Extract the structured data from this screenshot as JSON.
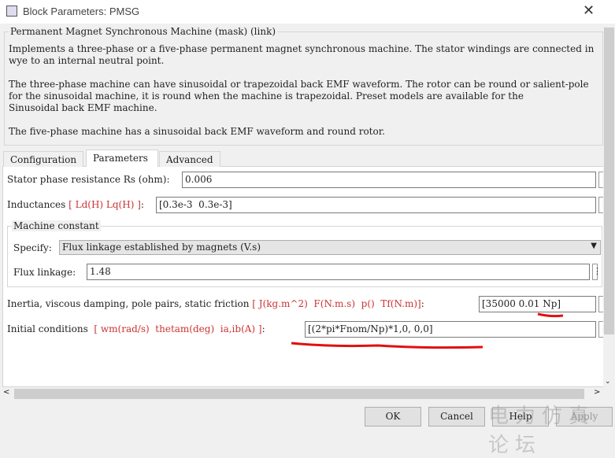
{
  "window": {
    "title": "Block Parameters: PMSG",
    "close_label": "✕"
  },
  "mask": {
    "title": "Permanent Magnet Synchronous Machine (mask) (link)",
    "description": [
      "Implements a three-phase or a five-phase permanent magnet synchronous machine. The stator windings are connected in\nwye to an internal neutral point.",
      "The three-phase machine can have sinusoidal or trapezoidal back EMF waveform. The rotor can be round or salient-pole\nfor the sinusoidal machine, it is round when the machine is trapezoidal. Preset models are available for the\nSinusoidal back EMF machine.",
      "The five-phase machine has a sinusoidal back EMF waveform and round rotor."
    ]
  },
  "tabs": [
    {
      "label": "Configuration"
    },
    {
      "label": "Parameters",
      "active": true
    },
    {
      "label": "Advanced"
    }
  ],
  "params": {
    "rs": {
      "label": "Stator phase resistance Rs (ohm):",
      "value": "0.006"
    },
    "ind": {
      "label": "Inductances ",
      "bracket": "[ Ld(H) Lq(H) ]",
      "colon": ":",
      "value": "[0.3e-3  0.3e-3]"
    },
    "machine_constant": {
      "title": "Machine constant",
      "specify_label": "Specify:",
      "specify_value": "Flux linkage established by magnets (V.s)",
      "flux_label": "Flux linkage:",
      "flux_value": "1.48"
    },
    "inertia": {
      "label": "Inertia, viscous damping, pole pairs, static friction ",
      "bracket": "[ J(kg.m^2)  F(N.m.s)  p()  Tf(N.m)]",
      "colon": ":",
      "value": "[35000 0.01 Np]"
    },
    "initial": {
      "label": "Initial conditions  ",
      "bracket": "[ wm(rad/s)  thetam(deg)  ia,ib(A) ]",
      "colon": ":",
      "value": "[(2*pi*Fnom/Np)*1,0, 0,0]"
    }
  },
  "buttons": {
    "ok": "OK",
    "cancel": "Cancel",
    "help": "Help",
    "apply": "Apply"
  },
  "watermark": "电力仿真论坛",
  "colors": {
    "annotation": "#e01010",
    "bracket": "#c33"
  }
}
